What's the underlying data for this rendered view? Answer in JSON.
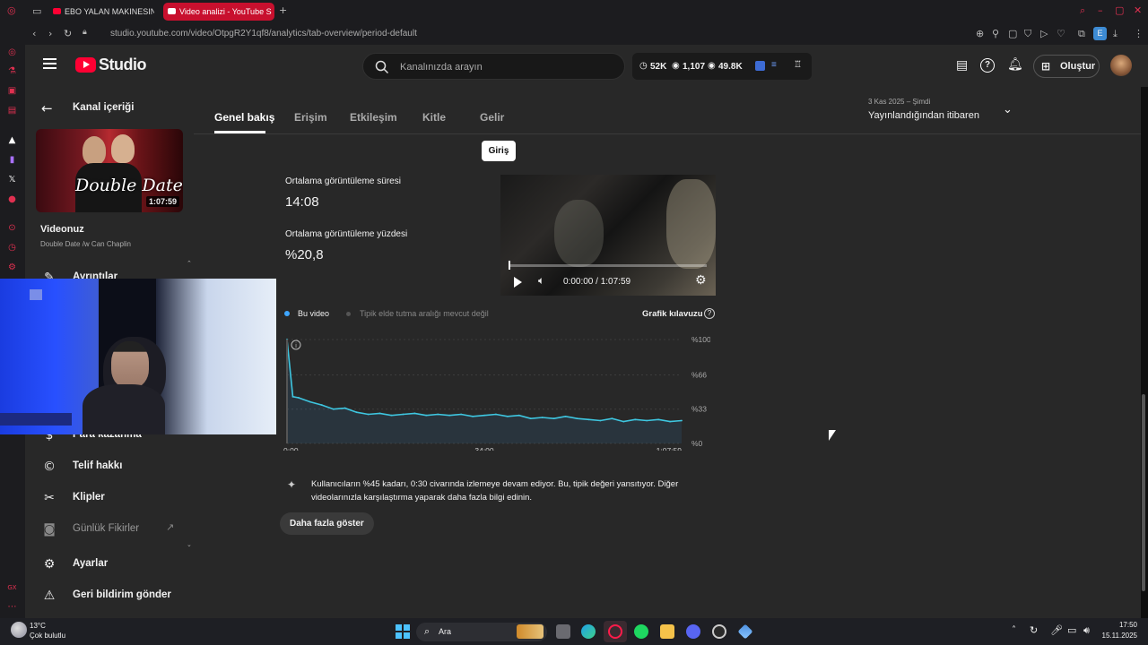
{
  "browser": {
    "tabs": [
      {
        "label": "EBO YALAN MAKINESINDE"
      },
      {
        "label": "Video analizi - YouTube S"
      }
    ],
    "url": "studio.youtube.com/video/OtpgR2Y1qf8/analytics/tab-overview/period-default"
  },
  "header": {
    "logo_text": "Studio",
    "search_placeholder": "Kanalınızda arayın",
    "stats": {
      "subs": "52K",
      "views": "1,107",
      "watch": "49.8K"
    },
    "create_label": "Oluştur"
  },
  "sidebar": {
    "back_label": "Kanal içeriği",
    "video_duration": "1:07:59",
    "thumb_text": "Double Date",
    "video_heading": "Videonuz",
    "video_title": "Double Date /w Can Chaplin",
    "items": [
      {
        "label": "Ayrıntılar",
        "icon": "pencil-icon"
      },
      {
        "label": "Para kazanma",
        "icon": "dollar-icon"
      },
      {
        "label": "Telif hakkı",
        "icon": "copyright-icon"
      },
      {
        "label": "Klipler",
        "icon": "scissors-icon"
      },
      {
        "label": "Günlük Fikirler",
        "icon": "idea-icon"
      },
      {
        "label": "Ayarlar",
        "icon": "gear-icon"
      },
      {
        "label": "Geri bildirim gönder",
        "icon": "feedback-icon"
      }
    ]
  },
  "main": {
    "tabs": [
      {
        "label": "Genel bakış",
        "active": true
      },
      {
        "label": "Erişim"
      },
      {
        "label": "Etkileşim"
      },
      {
        "label": "Kitle"
      },
      {
        "label": "Gelir"
      }
    ],
    "date_range_small": "3 Kas 2025 – Şimdi",
    "date_range": "Yayınlandığından itibaren",
    "section_chip": "Giriş",
    "avg_view_duration_label": "Ortalama görüntüleme süresi",
    "avg_view_duration": "14:08",
    "avg_view_percent_label": "Ortalama görüntüleme yüzdesi",
    "avg_view_percent": "%20,8",
    "player_time": "0:00:00 / 1:07:59",
    "legend_this": "Bu video",
    "legend_typical": "Tipik elde tutma aralığı mevcut değil",
    "chart_guide": "Grafik kılavuzu",
    "insight": "Kullanıcıların %45 kadarı, 0:30 civarında izlemeye devam ediyor. Bu, tipik değeri yansıtıyor. Diğer videolarınızla karşılaştırma yaparak daha fazla bilgi edinin.",
    "show_more": "Daha fazla göster"
  },
  "chart_data": {
    "type": "line",
    "x_ticks": [
      "0:00",
      "34:00",
      "1:07:59"
    ],
    "y_ticks": [
      "%100",
      "%66",
      "%33",
      "%0"
    ],
    "ylim": [
      0,
      100
    ],
    "series": [
      {
        "name": "Bu video",
        "x": [
          0,
          1,
          2,
          4,
          6,
          8,
          10,
          12,
          14,
          16,
          18,
          20,
          22,
          24,
          26,
          28,
          30,
          32,
          34,
          36,
          38,
          40,
          42,
          44,
          46,
          48,
          50,
          52,
          54,
          56,
          58,
          60,
          62,
          64,
          66,
          68
        ],
        "values": [
          100,
          45,
          44,
          40,
          37,
          33,
          34,
          30,
          28,
          29,
          27,
          28,
          29,
          27,
          28,
          27,
          28,
          26,
          27,
          28,
          26,
          27,
          24,
          25,
          24,
          26,
          24,
          23,
          22,
          24,
          21,
          23,
          22,
          23,
          21,
          22
        ]
      }
    ]
  },
  "taskbar": {
    "weather_temp": "13°C",
    "weather_desc": "Çok bulutlu",
    "search_label": "Ara",
    "time": "17:50",
    "date": "15.11.2025"
  }
}
